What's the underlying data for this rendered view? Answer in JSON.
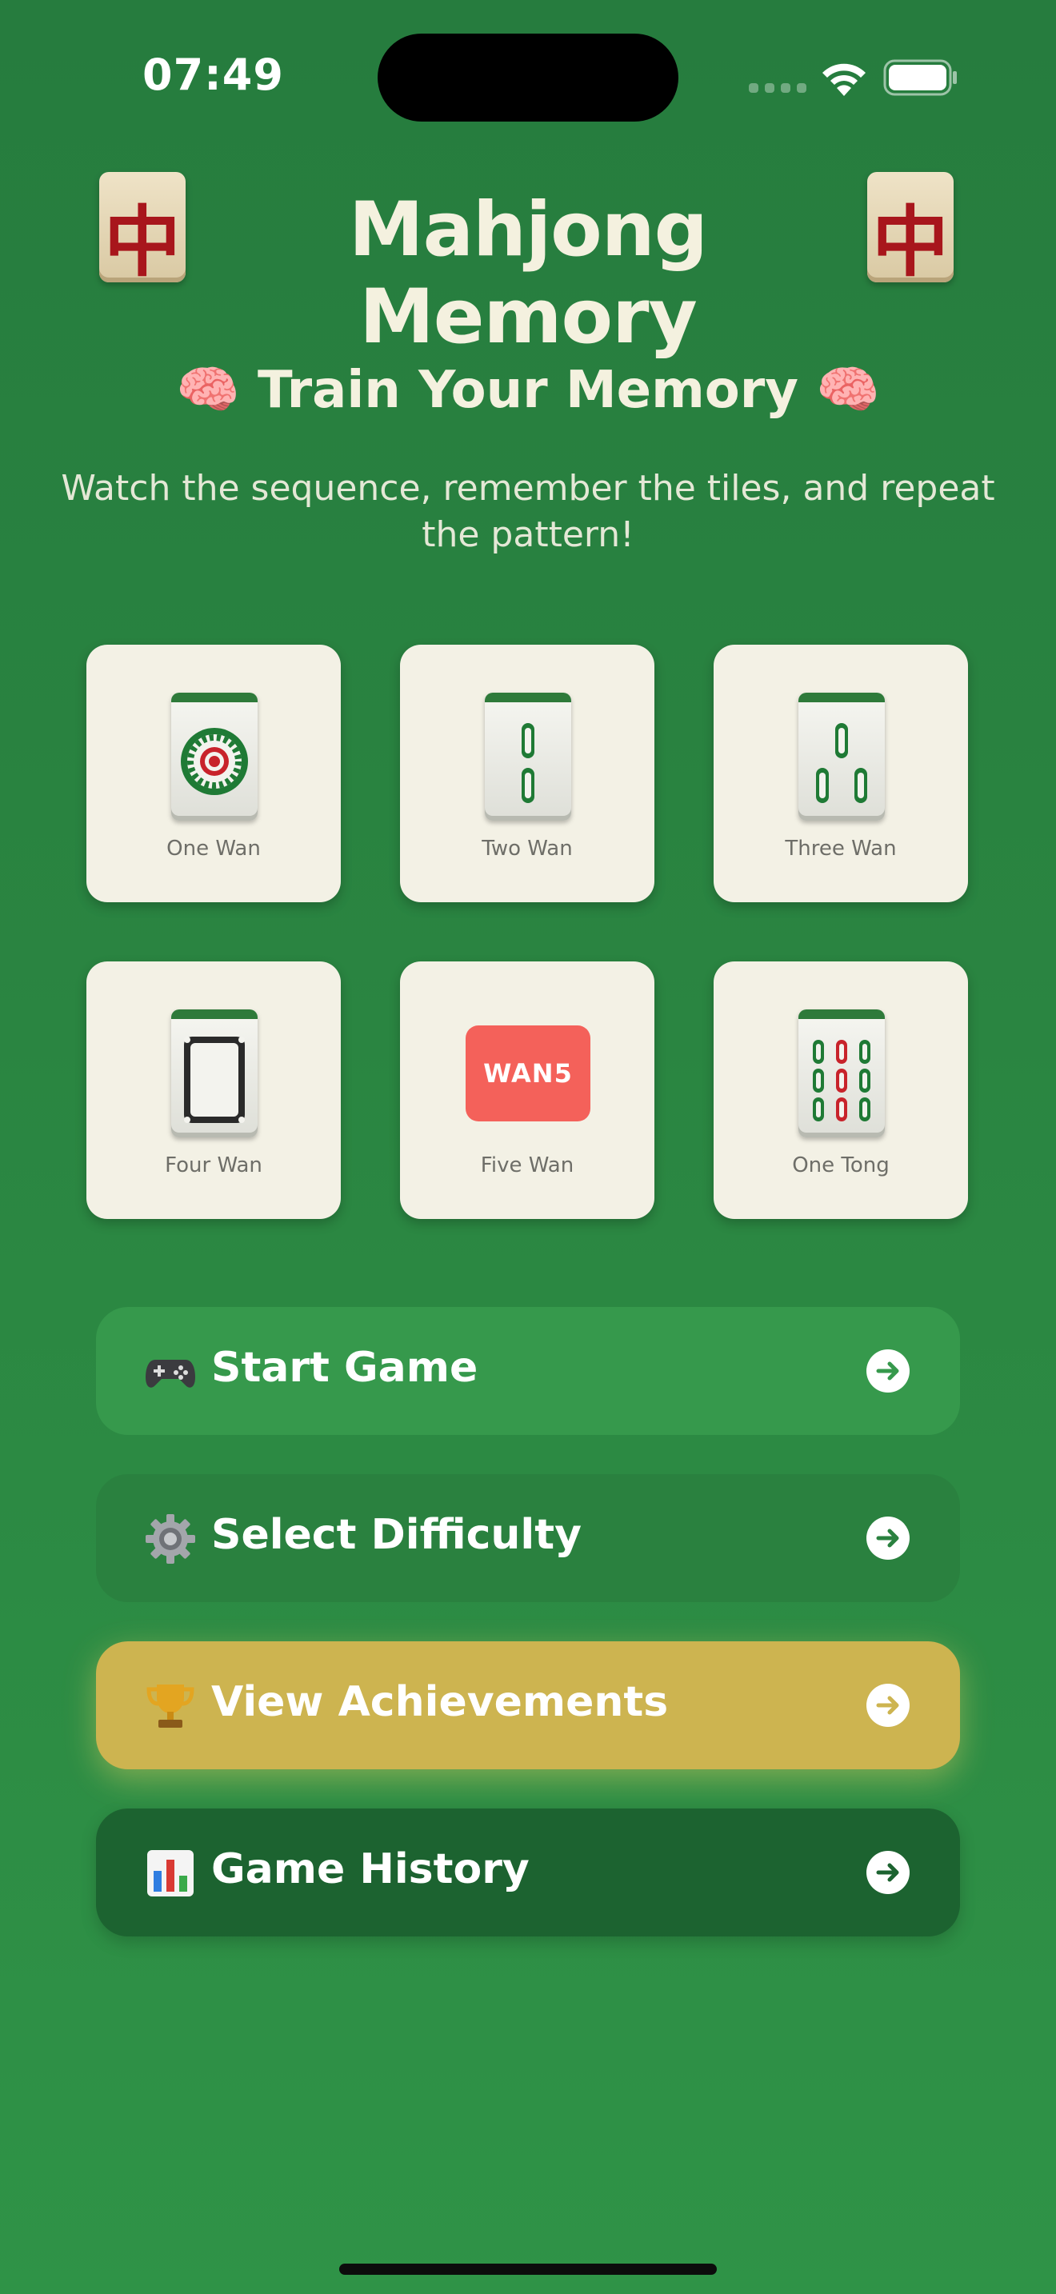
{
  "status_bar": {
    "time": "07:49"
  },
  "header": {
    "title": "Mahjong Memory",
    "tile_glyph": "中",
    "subtitle": "🧠 Train Your Memory 🧠",
    "description": "Watch the sequence, remember the tiles, and repeat the pattern!"
  },
  "tiles": [
    {
      "label": "One Wan",
      "icon": "one-dot-tile"
    },
    {
      "label": "Two Wan",
      "icon": "two-bamboo-tile"
    },
    {
      "label": "Three Wan",
      "icon": "three-bamboo-tile"
    },
    {
      "label": "Four Wan",
      "icon": "white-dragon-tile"
    },
    {
      "label": "Five Wan",
      "icon": "wan5-placeholder",
      "badge": "WAN5"
    },
    {
      "label": "One Tong",
      "icon": "nine-bamboo-tile"
    }
  ],
  "menu": {
    "start_game": "Start Game",
    "select_difficulty": "Select Difficulty",
    "view_achievements": "View Achievements",
    "game_history": "Game History"
  },
  "colors": {
    "background": "#2a8541",
    "start_button": "#36994c",
    "difficulty_button": "#2a813f",
    "achievements_button": "#cdb450",
    "history_button": "#1c6330",
    "tile_card": "#f3f1e5",
    "wan5_badge": "#f4615a"
  }
}
